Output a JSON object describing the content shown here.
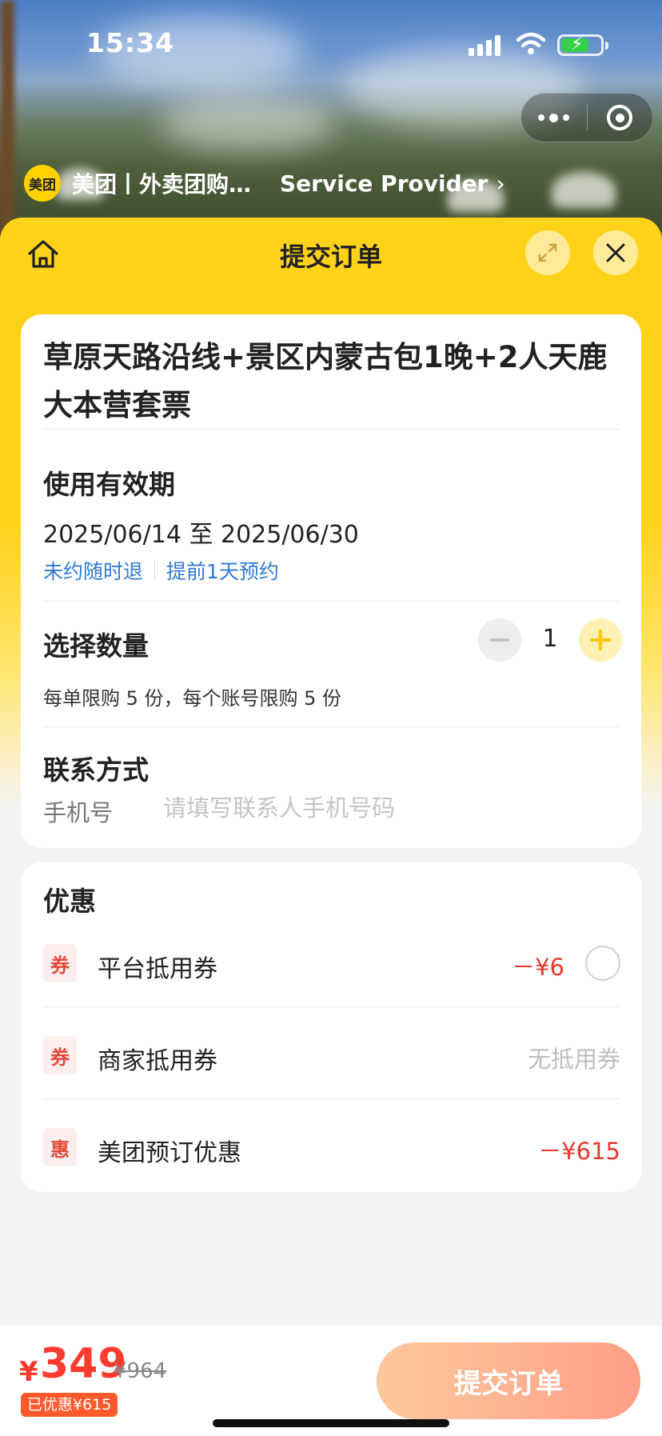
{
  "status_bar": {
    "time": "15:34"
  },
  "provider": {
    "logo_text": "美团",
    "name": "美团丨外卖团购…",
    "service_provider_label": "Service Provider"
  },
  "header": {
    "title": "提交订单"
  },
  "product": {
    "title": "草原天路沿线+景区内蒙古包1晚+2人天鹿大本营套票"
  },
  "validity": {
    "title": "使用有效期",
    "dates": "2025/06/14 至 2025/06/30",
    "tags": [
      "未约随时退",
      "提前1天预约"
    ]
  },
  "quantity": {
    "title": "选择数量",
    "value": "1",
    "limit_note": "每单限购 5 份，每个账号限购 5 份"
  },
  "contact": {
    "title": "联系方式",
    "phone_label": "手机号",
    "phone_placeholder": "请填写联系人手机号码"
  },
  "promotions": {
    "title": "优惠",
    "items": [
      {
        "badge": "券",
        "label": "平台抵用券",
        "value": "－¥6"
      },
      {
        "badge": "券",
        "label": "商家抵用券",
        "value": "无抵用券"
      },
      {
        "badge": "惠",
        "label": "美团预订优惠",
        "value": "－¥615"
      }
    ]
  },
  "footer": {
    "currency": "¥",
    "price": "349",
    "original_price": "¥964",
    "saved_label": "已优惠¥615",
    "submit_label": "提交订单"
  },
  "colors": {
    "brand_yellow": "#ffd21a",
    "price_red": "#ff3b2f",
    "link_blue": "#2f7ad6",
    "submit_gradient_start": "#fbc89c",
    "submit_gradient_end": "#ff9f86"
  },
  "icons": {
    "home": "home-icon",
    "expand": "expand-icon",
    "close": "close-icon",
    "more": "more-dots-icon",
    "mini_program_close": "target-circle-icon",
    "chevron": "chevron-right-icon"
  }
}
